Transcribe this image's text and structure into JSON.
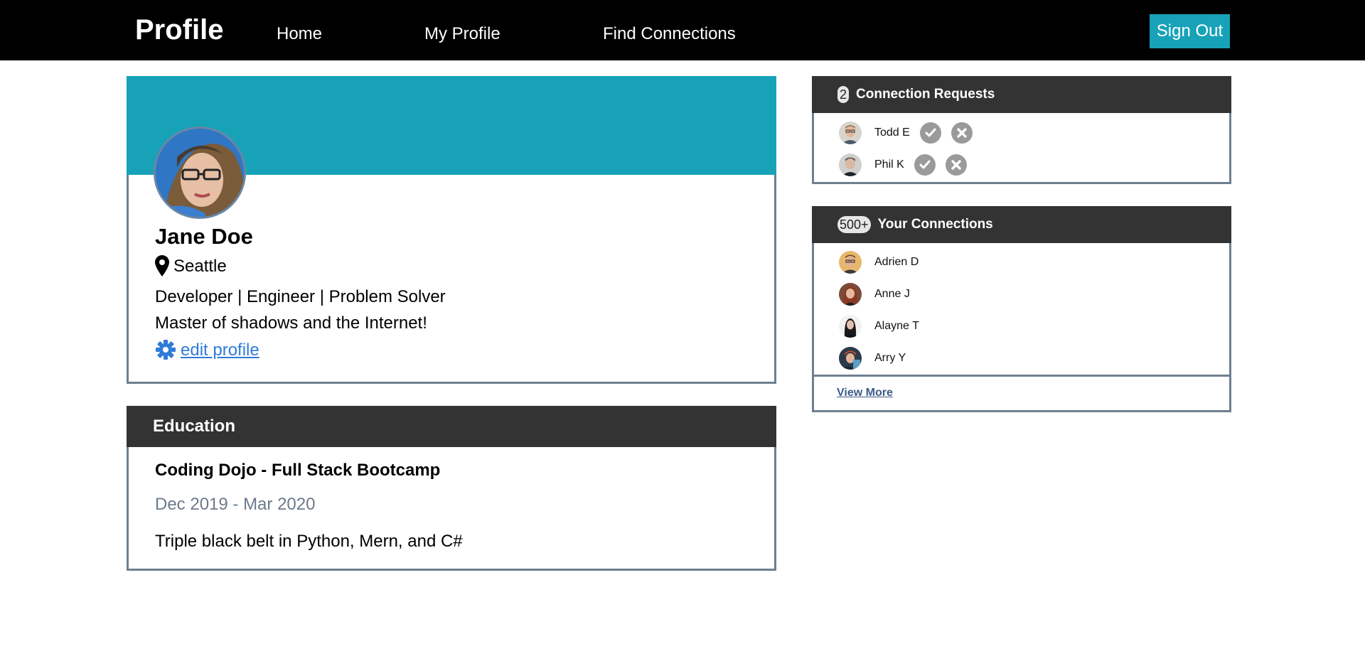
{
  "nav": {
    "brand": "Profile",
    "links": [
      "Home",
      "My Profile",
      "Find Connections"
    ],
    "sign_out": "Sign Out"
  },
  "profile": {
    "name": "Jane Doe",
    "location": "Seattle",
    "title": "Developer | Engineer | Problem Solver",
    "bio": "Master of shadows and the Internet!",
    "edit_label": "edit profile",
    "banner_color": "#17a2b8",
    "link_color": "#2f7bd8"
  },
  "education": {
    "header": "Education",
    "school": "Coding Dojo - Full Stack Bootcamp",
    "dates": "Dec 2019 - Mar 2020",
    "description": "Triple black belt in Python, Mern, and C#"
  },
  "requests": {
    "count": "2",
    "header": "Connection Requests",
    "items": [
      {
        "name": "Todd E"
      },
      {
        "name": "Phil K"
      }
    ]
  },
  "connections": {
    "count": "500+",
    "header": "Your Connections",
    "items": [
      {
        "name": "Adrien D"
      },
      {
        "name": "Anne J"
      },
      {
        "name": "Alayne T"
      },
      {
        "name": "Arry Y"
      }
    ],
    "view_more": "View More"
  },
  "icons": {
    "location": "map-pin-icon",
    "edit": "gear-icon",
    "accept": "check-icon",
    "decline": "close-icon"
  }
}
